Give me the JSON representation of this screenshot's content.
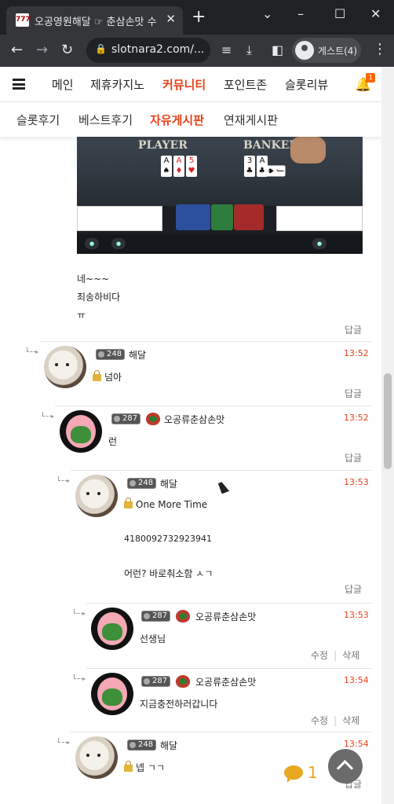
{
  "browser": {
    "tab_title": "오공영원해달 ☞ 춘삼손맛 수",
    "url": "slotnara2.com/...",
    "profile_label": "게스트(4)"
  },
  "nav": {
    "main_items": [
      "메인",
      "제휴카지노",
      "커뮤니티",
      "포인트존",
      "슬롯리뷰"
    ],
    "active_main": "커뮤니티",
    "notification_count": "1",
    "sub_items": [
      "슬롯후기",
      "베스트후기",
      "자유게시판",
      "연재게시판"
    ],
    "active_sub": "자유게시판"
  },
  "video": {
    "player_label": "PLAYER",
    "banker_label": "BANKER"
  },
  "post": {
    "lines": [
      "네~~~",
      "죄송하비다",
      "ㅠ"
    ],
    "reply_label": "답글"
  },
  "comments": [
    {
      "level": "248",
      "nick": "해달",
      "time": "13:52",
      "locked": true,
      "text": [
        "넘아"
      ],
      "action": "답글"
    },
    {
      "level": "287",
      "nick": "오공류춘삼손맛",
      "time": "13:52",
      "locked": false,
      "text": [
        "런"
      ],
      "action": "답글"
    },
    {
      "level": "248",
      "nick": "해달",
      "time": "13:53",
      "locked": true,
      "text": [
        "One More Time",
        "4180092732923941",
        "어런? 바로춰소함 ㅅㄱ"
      ],
      "action": "답글"
    },
    {
      "level": "287",
      "nick": "오공류춘삼손맛",
      "time": "13:53",
      "locked": false,
      "text": [
        "선생님"
      ],
      "edit": "수정",
      "delete": "삭제"
    },
    {
      "level": "287",
      "nick": "오공류춘삼손맛",
      "time": "13:54",
      "locked": false,
      "text": [
        "지금충전하러갑니다"
      ],
      "edit": "수정",
      "delete": "삭제"
    },
    {
      "level": "248",
      "nick": "해달",
      "time": "13:54",
      "locked": true,
      "text": [
        "넵 ㄱㄱ"
      ],
      "action": "답글"
    }
  ],
  "floating": {
    "comment_count": "1"
  },
  "colors": {
    "accent": "#e8421a",
    "time": "#e8421a",
    "comment_count": "#e8a820"
  }
}
